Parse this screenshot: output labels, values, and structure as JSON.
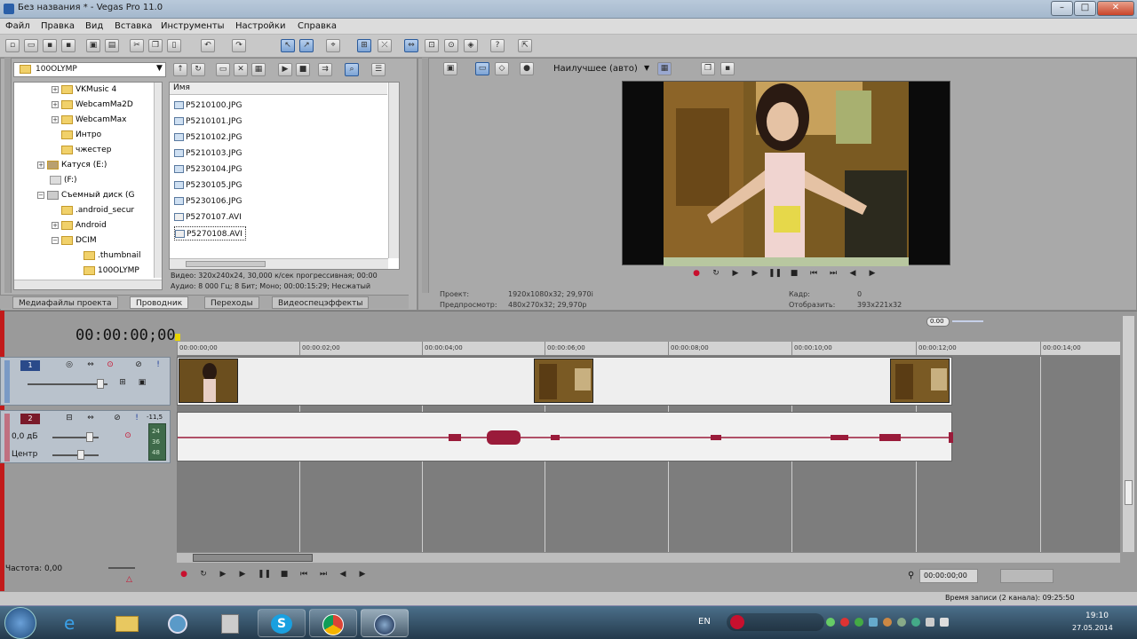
{
  "window": {
    "title": "Без названия * - Vegas Pro 11.0",
    "min": "–",
    "max": "□",
    "close": "✕"
  },
  "menu": [
    "Файл",
    "Правка",
    "Вид",
    "Вставка",
    "Инструменты",
    "Настройки",
    "Справка"
  ],
  "explorer": {
    "path": "100OLYMP",
    "tree": [
      {
        "label": "VKMusic 4"
      },
      {
        "label": "WebcamMa2D"
      },
      {
        "label": "WebcamMax"
      },
      {
        "label": "Интро"
      },
      {
        "label": "чжестер"
      },
      {
        "label": "Катуся (E:)"
      },
      {
        "label": "(F:)"
      },
      {
        "label": "Съемный диск (G"
      },
      {
        "label": ".android_secur"
      },
      {
        "label": "Android"
      },
      {
        "label": "DCIM"
      },
      {
        "label": ".thumbnail"
      },
      {
        "label": "100OLYMP"
      }
    ],
    "column_name": "Имя",
    "files": [
      "P5210100.JPG",
      "P5210101.JPG",
      "P5210102.JPG",
      "P5210103.JPG",
      "P5230104.JPG",
      "P5230105.JPG",
      "P5230106.JPG",
      "P5270107.AVI",
      "P5270108.AVI"
    ],
    "info_line1": "Видео: 320x240x24, 30,000 к/сек прогрессивная; 00:00",
    "info_line2": "Аудио: 8 000 Гц; 8 Бит; Моно; 00:00:15:29; Несжатый"
  },
  "tabs": [
    "Медиафайлы проекта",
    "Проводник",
    "Переходы",
    "Видеоспецэффекты"
  ],
  "preview": {
    "quality": "Наилучшее (авто)",
    "project_label": "Проект:",
    "project_value": "1920x1080x32; 29,970i",
    "preview_label": "Предпросмотр:",
    "preview_value": "480x270x32; 29,970p",
    "frame_label": "Кадр:",
    "frame_value": "0",
    "display_label": "Отобразить:",
    "display_value": "393x221x32"
  },
  "timeline": {
    "timecode": "00:00:00;00",
    "zoom_badge": "0.00",
    "ruler": [
      "00:00:00;00",
      "00:00:02;00",
      "00:00:04;00",
      "00:00:06;00",
      "00:00:08;00",
      "00:00:10;00",
      "00:00:12;00",
      "00:00:14;00"
    ],
    "video_track_num": "1",
    "audio_track_num": "2",
    "audio_volume": "0,0 дБ",
    "audio_pan": "Центр",
    "meter_top": "-11,5",
    "meter_vals": [
      "24",
      "36",
      "48"
    ]
  },
  "bottom": {
    "rate": "Частота: 0,00",
    "cursor_time": "00:00:00;00",
    "record_time": "Время записи (2 канала): 09:25:50"
  },
  "taskbar": {
    "lang": "EN",
    "time": "19:10",
    "date": "27.05.2014"
  },
  "colors": {
    "accent": "#3a6ea5",
    "audio_wave": "#9a1b3a",
    "record": "#c8102e"
  }
}
